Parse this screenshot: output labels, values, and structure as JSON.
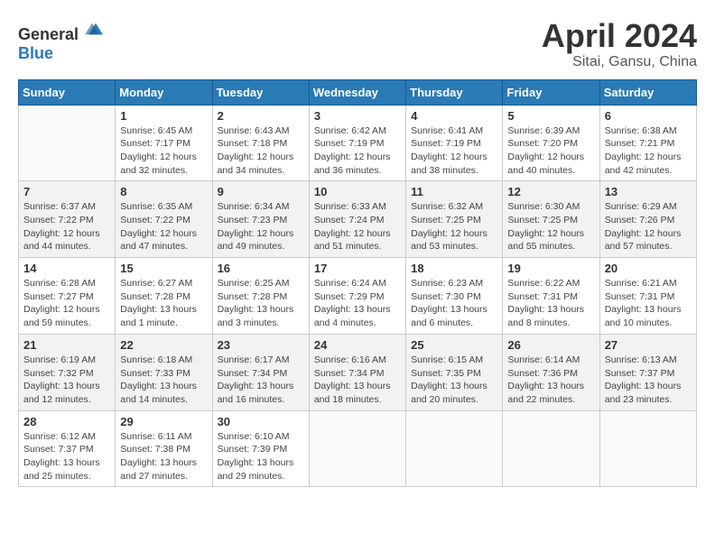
{
  "header": {
    "logo_general": "General",
    "logo_blue": "Blue",
    "month": "April 2024",
    "location": "Sitai, Gansu, China"
  },
  "columns": [
    "Sunday",
    "Monday",
    "Tuesday",
    "Wednesday",
    "Thursday",
    "Friday",
    "Saturday"
  ],
  "weeks": [
    [
      {
        "day": "",
        "info": ""
      },
      {
        "day": "1",
        "info": "Sunrise: 6:45 AM\nSunset: 7:17 PM\nDaylight: 12 hours\nand 32 minutes."
      },
      {
        "day": "2",
        "info": "Sunrise: 6:43 AM\nSunset: 7:18 PM\nDaylight: 12 hours\nand 34 minutes."
      },
      {
        "day": "3",
        "info": "Sunrise: 6:42 AM\nSunset: 7:19 PM\nDaylight: 12 hours\nand 36 minutes."
      },
      {
        "day": "4",
        "info": "Sunrise: 6:41 AM\nSunset: 7:19 PM\nDaylight: 12 hours\nand 38 minutes."
      },
      {
        "day": "5",
        "info": "Sunrise: 6:39 AM\nSunset: 7:20 PM\nDaylight: 12 hours\nand 40 minutes."
      },
      {
        "day": "6",
        "info": "Sunrise: 6:38 AM\nSunset: 7:21 PM\nDaylight: 12 hours\nand 42 minutes."
      }
    ],
    [
      {
        "day": "7",
        "info": "Sunrise: 6:37 AM\nSunset: 7:22 PM\nDaylight: 12 hours\nand 44 minutes."
      },
      {
        "day": "8",
        "info": "Sunrise: 6:35 AM\nSunset: 7:22 PM\nDaylight: 12 hours\nand 47 minutes."
      },
      {
        "day": "9",
        "info": "Sunrise: 6:34 AM\nSunset: 7:23 PM\nDaylight: 12 hours\nand 49 minutes."
      },
      {
        "day": "10",
        "info": "Sunrise: 6:33 AM\nSunset: 7:24 PM\nDaylight: 12 hours\nand 51 minutes."
      },
      {
        "day": "11",
        "info": "Sunrise: 6:32 AM\nSunset: 7:25 PM\nDaylight: 12 hours\nand 53 minutes."
      },
      {
        "day": "12",
        "info": "Sunrise: 6:30 AM\nSunset: 7:25 PM\nDaylight: 12 hours\nand 55 minutes."
      },
      {
        "day": "13",
        "info": "Sunrise: 6:29 AM\nSunset: 7:26 PM\nDaylight: 12 hours\nand 57 minutes."
      }
    ],
    [
      {
        "day": "14",
        "info": "Sunrise: 6:28 AM\nSunset: 7:27 PM\nDaylight: 12 hours\nand 59 minutes."
      },
      {
        "day": "15",
        "info": "Sunrise: 6:27 AM\nSunset: 7:28 PM\nDaylight: 13 hours\nand 1 minute."
      },
      {
        "day": "16",
        "info": "Sunrise: 6:25 AM\nSunset: 7:28 PM\nDaylight: 13 hours\nand 3 minutes."
      },
      {
        "day": "17",
        "info": "Sunrise: 6:24 AM\nSunset: 7:29 PM\nDaylight: 13 hours\nand 4 minutes."
      },
      {
        "day": "18",
        "info": "Sunrise: 6:23 AM\nSunset: 7:30 PM\nDaylight: 13 hours\nand 6 minutes."
      },
      {
        "day": "19",
        "info": "Sunrise: 6:22 AM\nSunset: 7:31 PM\nDaylight: 13 hours\nand 8 minutes."
      },
      {
        "day": "20",
        "info": "Sunrise: 6:21 AM\nSunset: 7:31 PM\nDaylight: 13 hours\nand 10 minutes."
      }
    ],
    [
      {
        "day": "21",
        "info": "Sunrise: 6:19 AM\nSunset: 7:32 PM\nDaylight: 13 hours\nand 12 minutes."
      },
      {
        "day": "22",
        "info": "Sunrise: 6:18 AM\nSunset: 7:33 PM\nDaylight: 13 hours\nand 14 minutes."
      },
      {
        "day": "23",
        "info": "Sunrise: 6:17 AM\nSunset: 7:34 PM\nDaylight: 13 hours\nand 16 minutes."
      },
      {
        "day": "24",
        "info": "Sunrise: 6:16 AM\nSunset: 7:34 PM\nDaylight: 13 hours\nand 18 minutes."
      },
      {
        "day": "25",
        "info": "Sunrise: 6:15 AM\nSunset: 7:35 PM\nDaylight: 13 hours\nand 20 minutes."
      },
      {
        "day": "26",
        "info": "Sunrise: 6:14 AM\nSunset: 7:36 PM\nDaylight: 13 hours\nand 22 minutes."
      },
      {
        "day": "27",
        "info": "Sunrise: 6:13 AM\nSunset: 7:37 PM\nDaylight: 13 hours\nand 23 minutes."
      }
    ],
    [
      {
        "day": "28",
        "info": "Sunrise: 6:12 AM\nSunset: 7:37 PM\nDaylight: 13 hours\nand 25 minutes."
      },
      {
        "day": "29",
        "info": "Sunrise: 6:11 AM\nSunset: 7:38 PM\nDaylight: 13 hours\nand 27 minutes."
      },
      {
        "day": "30",
        "info": "Sunrise: 6:10 AM\nSunset: 7:39 PM\nDaylight: 13 hours\nand 29 minutes."
      },
      {
        "day": "",
        "info": ""
      },
      {
        "day": "",
        "info": ""
      },
      {
        "day": "",
        "info": ""
      },
      {
        "day": "",
        "info": ""
      }
    ]
  ]
}
